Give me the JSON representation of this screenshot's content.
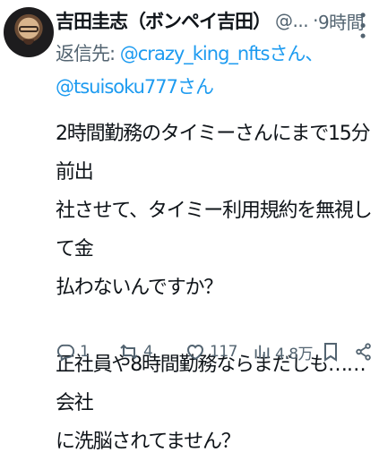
{
  "tweet": {
    "author_name": "吉田圭志（ボンペイ吉田）",
    "handle": "@...",
    "dot": "·",
    "time": "9時間",
    "more_icon": "more-dots-icon",
    "reply_label": "返信先:",
    "reply_to_1": "@crazy_king_nftsさん、",
    "reply_to_2": "@tsuisoku777さん",
    "body": "2時間勤務のタイミーさんにまで15分前出\n社させて、タイミー利用規約を無視して金\n払わないんですか？\n\n正社員や8時間勤務ならまだしも……会社\nに洗脳されてません？",
    "actions": {
      "reply_count": "1",
      "retweet_count": "4",
      "like_count": "117",
      "view_count": "4.8万",
      "reply_icon": "reply-icon",
      "retweet_icon": "retweet-icon",
      "like_icon": "heart-icon",
      "view_icon": "views-icon",
      "bookmark_icon": "bookmark-icon",
      "share_icon": "share-icon"
    },
    "colors": {
      "text": "#0f1419",
      "muted": "#536471",
      "link": "#1d9bf0"
    }
  }
}
